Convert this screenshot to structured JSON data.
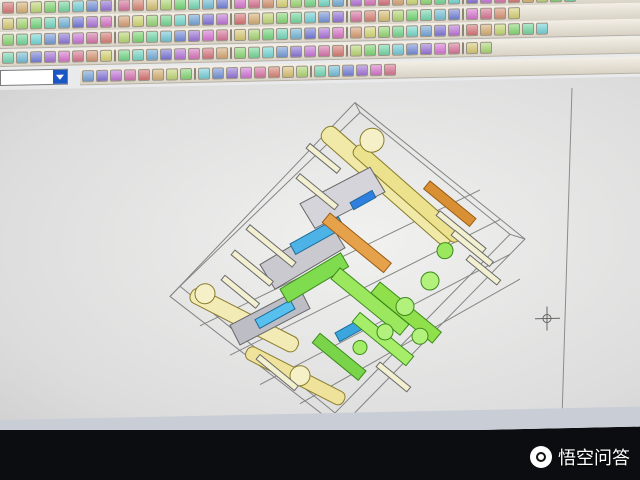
{
  "screen": {
    "toolbar_rows": 5,
    "buttons_per_row": [
      44,
      40,
      42,
      38,
      24
    ],
    "view_combo": {
      "value": ""
    },
    "colors": {
      "background": "#e9eaec",
      "toolbar": "#e8e1d4",
      "wireframe": "#5a5a5a",
      "part_yellow": "#f0e9a8",
      "part_green": "#7fdc4f",
      "part_blue": "#4db3e6",
      "part_orange": "#e6a24b"
    },
    "icons": [
      "line-icon",
      "circle-icon",
      "rectangle-icon",
      "arc-icon",
      "zoom-icon",
      "rotate-icon",
      "pan-icon",
      "select-icon",
      "cut-icon",
      "dimension-icon"
    ]
  },
  "watermark": {
    "text": "悟空问答"
  }
}
